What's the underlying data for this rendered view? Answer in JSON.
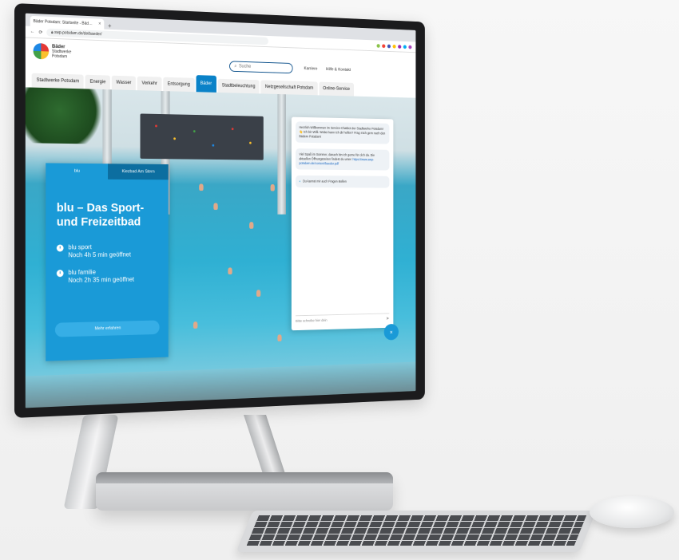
{
  "browser": {
    "tab_title": "Bäder Potsdam: Startseite - Bäd…",
    "url": "swp-potsdam.de/de/baeder/"
  },
  "header": {
    "logo_line1": "Bäder",
    "logo_line2": "Stadtwerke",
    "logo_line3": "Potsdam",
    "search_placeholder": "Suche",
    "link_karriere": "Karriere",
    "link_hilfe": "Hilfe & Kontakt"
  },
  "nav": {
    "items": [
      {
        "label": "Stadtwerke Potsdam"
      },
      {
        "label": "Energie"
      },
      {
        "label": "Wasser"
      },
      {
        "label": "Verkehr"
      },
      {
        "label": "Entsorgung"
      },
      {
        "label": "Bäder"
      },
      {
        "label": "Stadtbeleuchtung"
      },
      {
        "label": "Netzgesellschaft Potsdam"
      },
      {
        "label": "Online-Service"
      }
    ],
    "active_index": 5
  },
  "card": {
    "tab1": "blu",
    "tab2": "Kiezbad Am Stern",
    "title": "blu – Das Sport- und Freizeitbad",
    "status1_name": "blu sport",
    "status1_time": "Noch 4h 5 min geöffnet",
    "status2_name": "blu familie",
    "status2_time": "Noch 2h 35 min geöffnet",
    "button": "Mehr erfahren"
  },
  "chat": {
    "msg1": "Herzlich Willkommen im Service-Chatbot der Stadtwerke Potsdam! 👋 Ich bin Willi. Wobei kann ich dir helfen? Frag mich gern nach den Bädern Potsdam!",
    "msg2": "Viel Spaß im Sommer, danach bin ich gerne für dich da. Die aktuellen Öffnungszeiten findest du unter:",
    "msg2_link": "https://www.swp-potsdam.de/content/baeder.pdf",
    "msg3": "Du kannst mir auch Fragen stellen",
    "input_placeholder": "Bitte schreibe hier dein",
    "fab_label": "×"
  },
  "colors": {
    "brand_blue": "#1a9ad7",
    "nav_active": "#0a82c8"
  }
}
